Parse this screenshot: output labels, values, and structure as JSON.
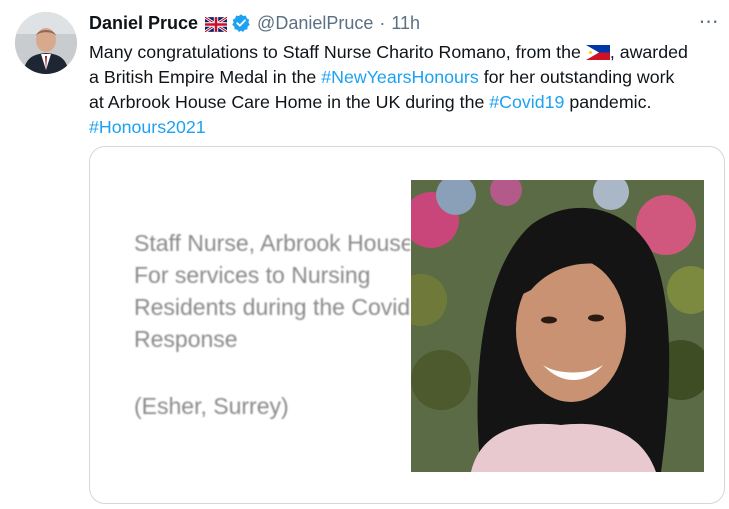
{
  "author": {
    "name": "Daniel Pruce",
    "handle": "@DanielPruce",
    "separator": "·",
    "time": "11h"
  },
  "more_label": "⋯",
  "tweet": {
    "line1_a": "Many congratulations to Staff Nurse Charito Romano, from the ",
    "line1_b": ", awarded",
    "line2_a": "a British Empire Medal in the ",
    "line2_tag": "#NewYearsHonours",
    "line2_b": " for her outstanding work",
    "line3_a": "at Arbrook House Care Home in the UK during the ",
    "line3_tag": "#Covid19",
    "line3_b": " pandemic.",
    "line4_tag": "#Honours2021"
  },
  "media": {
    "doc_lines": [
      "Staff Nurse, Arbrook House",
      "For services to Nursing",
      "Residents during the Covid",
      "Response"
    ],
    "doc_location": "(Esher, Surrey)"
  },
  "colors": {
    "hashtag": "#1da1f2",
    "secondary_text": "#5b7083",
    "verified": "#1da1f2",
    "border": "#cfd9de"
  },
  "icons": {
    "uk_flag": "uk-flag-icon",
    "verified": "verified-badge-icon",
    "ph_flag": "philippines-flag-icon",
    "more": "more-options-icon"
  }
}
